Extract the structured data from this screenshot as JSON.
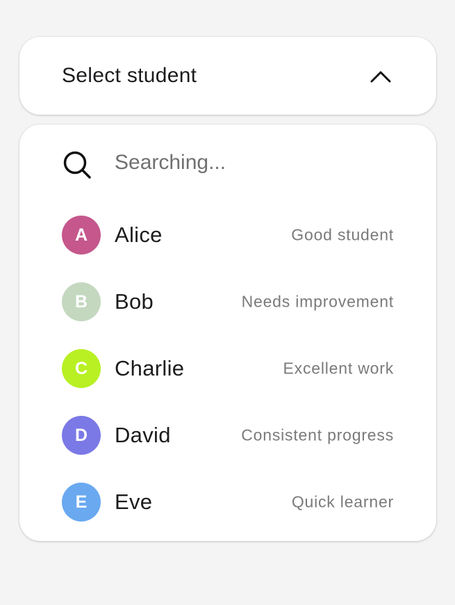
{
  "select": {
    "label": "Select student",
    "chevron_icon": "chevron-up-icon"
  },
  "search": {
    "icon": "search-icon",
    "placeholder": "Searching..."
  },
  "students": [
    {
      "initial": "A",
      "name": "Alice",
      "note": "Good student",
      "color": "#c5578c"
    },
    {
      "initial": "B",
      "name": "Bob",
      "note": "Needs improvement",
      "color": "#c4d8c0"
    },
    {
      "initial": "C",
      "name": "Charlie",
      "note": "Excellent work",
      "color": "#b8f024"
    },
    {
      "initial": "D",
      "name": "David",
      "note": "Consistent progress",
      "color": "#7b79e6"
    },
    {
      "initial": "E",
      "name": "Eve",
      "note": "Quick learner",
      "color": "#6aa9f0"
    }
  ]
}
